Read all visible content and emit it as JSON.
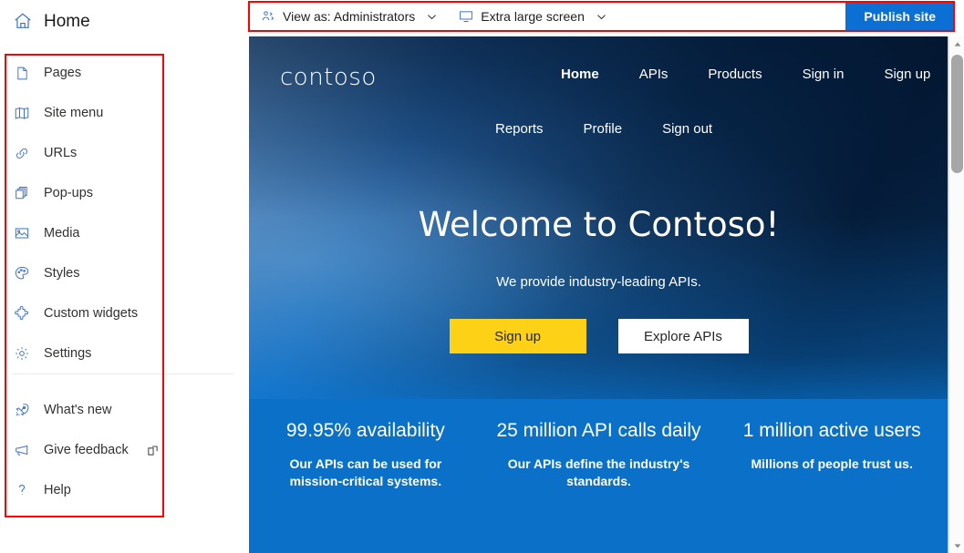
{
  "left_panel": {
    "header": {
      "label": "Home",
      "icon": "home-icon"
    },
    "items": [
      {
        "label": "Pages",
        "icon": "page-icon"
      },
      {
        "label": "Site menu",
        "icon": "book-icon"
      },
      {
        "label": "URLs",
        "icon": "link-icon"
      },
      {
        "label": "Pop-ups",
        "icon": "copy-icon"
      },
      {
        "label": "Media",
        "icon": "image-icon"
      },
      {
        "label": "Styles",
        "icon": "palette-icon"
      },
      {
        "label": "Custom widgets",
        "icon": "puzzle-icon"
      },
      {
        "label": "Settings",
        "icon": "gear-icon"
      }
    ],
    "footer_items": [
      {
        "label": "What's new",
        "icon": "rocket-icon"
      },
      {
        "label": "Give feedback",
        "icon": "megaphone-icon",
        "external": true
      },
      {
        "label": "Help",
        "icon": "question-icon"
      }
    ]
  },
  "toolbar": {
    "view_as": {
      "label": "View as: Administrators",
      "icon": "people-icon",
      "chevron": "chevron-down-icon"
    },
    "screen_size": {
      "label": "Extra large screen",
      "icon": "monitor-icon",
      "chevron": "chevron-down-icon"
    },
    "publish_label": "Publish site",
    "publish_color": "#0b6fd4"
  },
  "site": {
    "brand": "contoso",
    "nav_primary": [
      {
        "label": "Home",
        "active": true
      },
      {
        "label": "APIs",
        "active": false
      },
      {
        "label": "Products",
        "active": false
      },
      {
        "label": "Sign in",
        "active": false
      },
      {
        "label": "Sign up",
        "active": false
      }
    ],
    "nav_secondary": [
      {
        "label": "Reports"
      },
      {
        "label": "Profile"
      },
      {
        "label": "Sign out"
      }
    ],
    "hero": {
      "title": "Welcome to Contoso!",
      "subtitle": "We provide industry-leading APIs.",
      "primary_button": "Sign up",
      "secondary_button": "Explore APIs",
      "primary_button_color": "#fcd116",
      "secondary_button_color": "#ffffff"
    },
    "stats": [
      {
        "heading": "99.95% availability",
        "text": "Our APIs can be used for mission-critical systems."
      },
      {
        "heading": "25 million API calls daily",
        "text": "Our APIs define the industry's standards."
      },
      {
        "heading": "1 million active users",
        "text": "Millions of people trust us."
      }
    ],
    "stats_background": "#0b71c8"
  },
  "annotations": {
    "highlight_color": "#ff0000",
    "boxes": [
      "sidebar-nav-highlight",
      "toolbar-highlight"
    ]
  },
  "scrollbar": {
    "up_arrow": "scroll-up-icon",
    "down_arrow": "scroll-down-icon"
  }
}
